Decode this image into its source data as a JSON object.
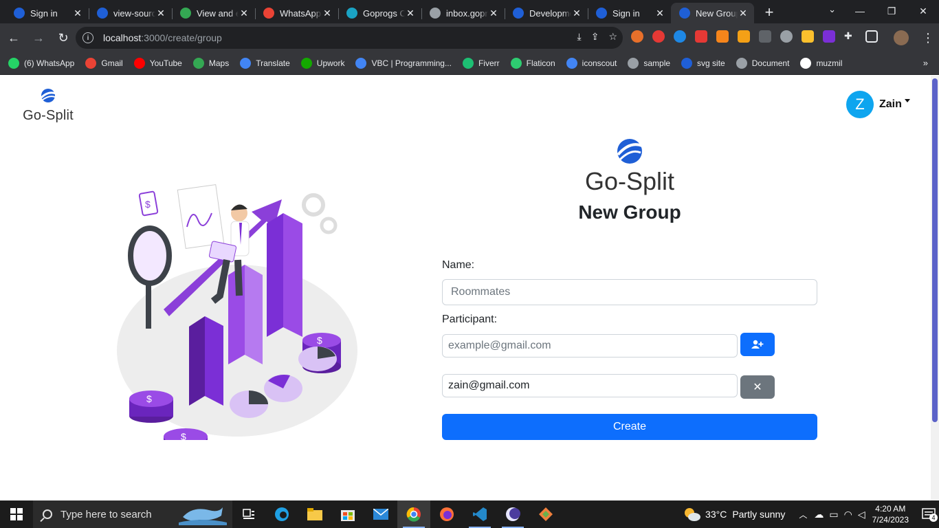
{
  "browser": {
    "tabs": [
      {
        "title": "Sign in",
        "icon": "gosplit-icon",
        "color": "#1f5fd6"
      },
      {
        "title": "view-source",
        "icon": "gosplit-icon",
        "color": "#1f5fd6"
      },
      {
        "title": "View and edit",
        "icon": "chrome-icon",
        "color": "#34a853"
      },
      {
        "title": "WhatsApp",
        "icon": "alert-icon",
        "color": "#ea4335"
      },
      {
        "title": "Goprogs Cloud",
        "icon": "goprogs-icon",
        "color": "#1aa3c4"
      },
      {
        "title": "inbox.goprogs",
        "icon": "globe-icon",
        "color": "#9aa0a6"
      },
      {
        "title": "Development",
        "icon": "gosplit-icon",
        "color": "#1f5fd6"
      },
      {
        "title": "Sign in",
        "icon": "gosplit-icon",
        "color": "#1f5fd6"
      },
      {
        "title": "New Group",
        "icon": "gosplit-icon",
        "color": "#1f5fd6",
        "active": true
      }
    ],
    "url_host": "localhost",
    "url_path": ":3000/create/group",
    "bookmarks": [
      {
        "label": "(6) WhatsApp",
        "icon": "whatsapp-icon",
        "color": "#25d366"
      },
      {
        "label": "Gmail",
        "icon": "gmail-icon",
        "color": "#ea4335"
      },
      {
        "label": "YouTube",
        "icon": "youtube-icon",
        "color": "#ff0000"
      },
      {
        "label": "Maps",
        "icon": "maps-icon",
        "color": "#34a853"
      },
      {
        "label": "Translate",
        "icon": "translate-icon",
        "color": "#4285f4"
      },
      {
        "label": "Upwork",
        "icon": "upwork-icon",
        "color": "#14a800"
      },
      {
        "label": "VBC | Programming...",
        "icon": "vbc-icon",
        "color": "#4285f4"
      },
      {
        "label": "Fiverr",
        "icon": "fiverr-icon",
        "color": "#1dbf73"
      },
      {
        "label": "Flaticon",
        "icon": "flaticon-icon",
        "color": "#2ecc71"
      },
      {
        "label": "iconscout",
        "icon": "iconscout-icon",
        "color": "#4285f4"
      },
      {
        "label": "sample",
        "icon": "globe-icon",
        "color": "#9aa0a6"
      },
      {
        "label": "svg site",
        "icon": "svg-icon",
        "color": "#1f5fd6"
      },
      {
        "label": "Document",
        "icon": "globe-icon",
        "color": "#9aa0a6"
      },
      {
        "label": "muzmil",
        "icon": "github-icon",
        "color": "#ffffff"
      }
    ]
  },
  "app": {
    "brand": "Go-Split",
    "user_initial": "Z",
    "user_name": "Zain",
    "form": {
      "title": "New Group",
      "name_label": "Name:",
      "name_placeholder": "Roommates",
      "participant_label": "Participant:",
      "participant_placeholder": "example@gmail.com",
      "participants": [
        "zain@gmail.com"
      ],
      "create_label": "Create"
    }
  },
  "taskbar": {
    "search_placeholder": "Type here to search",
    "weather_temp": "33°C",
    "weather_desc": "Partly sunny",
    "time": "4:20 AM",
    "date": "7/24/2023",
    "notification_count": "4"
  },
  "colors": {
    "primary": "#0d6efd",
    "secondary": "#6c757d",
    "avatar": "#0ea5ef",
    "illustration_purple": "#7b2fd6"
  }
}
